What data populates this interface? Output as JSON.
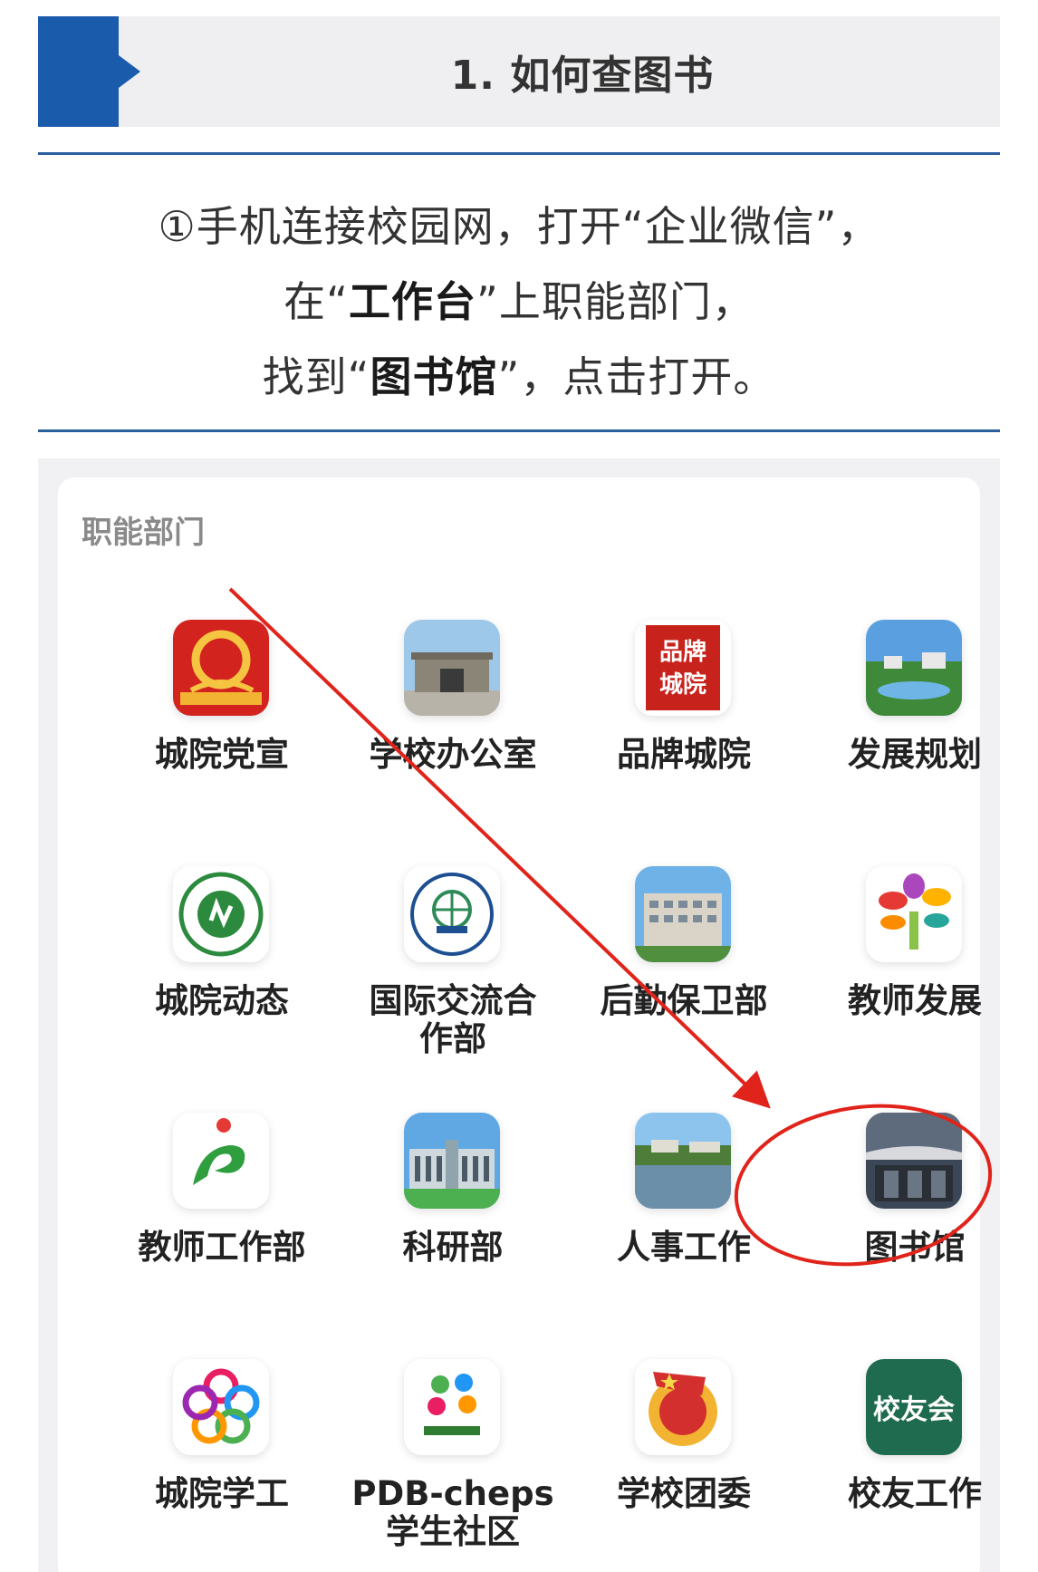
{
  "header": {
    "title": "1. 如何查图书"
  },
  "instructions": {
    "line1": "①手机连接校园网，打开“企业微信”，",
    "line2_pre": "在“",
    "line2_bold": "工作台",
    "line2_post": "”上职能部门，",
    "line3_pre": "找到“",
    "line3_bold": "图书馆",
    "line3_post": "”，点击打开。"
  },
  "screenshot": {
    "section_label": "职能部门",
    "apps": [
      {
        "label": "城院党宣",
        "icon": "party-emblem-icon"
      },
      {
        "label": "学校办公室",
        "icon": "office-building-icon"
      },
      {
        "label": "品牌城院",
        "icon": "brand-seal-icon"
      },
      {
        "label": "发展规划",
        "icon": "campus-landscape-icon"
      },
      {
        "label": "城院动态",
        "icon": "university-logo-icon"
      },
      {
        "label": "国际交流合作部",
        "icon": "globe-seal-icon"
      },
      {
        "label": "后勤保卫部",
        "icon": "dormitory-building-icon"
      },
      {
        "label": "教师发展",
        "icon": "colorful-tree-icon"
      },
      {
        "label": "教师工作部",
        "icon": "green-swirl-icon"
      },
      {
        "label": "科研部",
        "icon": "research-building-icon"
      },
      {
        "label": "人事工作",
        "icon": "lake-view-icon"
      },
      {
        "label": "图书馆",
        "icon": "library-building-icon"
      },
      {
        "label": "城院学工",
        "icon": "colorful-flower-icon"
      },
      {
        "label": "PDB-cheps学生社区",
        "icon": "student-community-icon"
      },
      {
        "label": "学校团委",
        "icon": "youth-league-icon"
      },
      {
        "label": "校友工作",
        "icon": "alumni-badge-icon"
      }
    ],
    "labels_split": {
      "intl_line1": "国际交流合",
      "intl_line2": "作部",
      "pdb_line1": "PDB-cheps",
      "pdb_line2": "学生社区"
    },
    "icon_texts": {
      "brand_seal_1": "品牌",
      "brand_seal_2": "城院",
      "alumni_badge": "校友会"
    }
  },
  "colors": {
    "accent_blue": "#1a5bab",
    "annotation_red": "#e0241b"
  }
}
